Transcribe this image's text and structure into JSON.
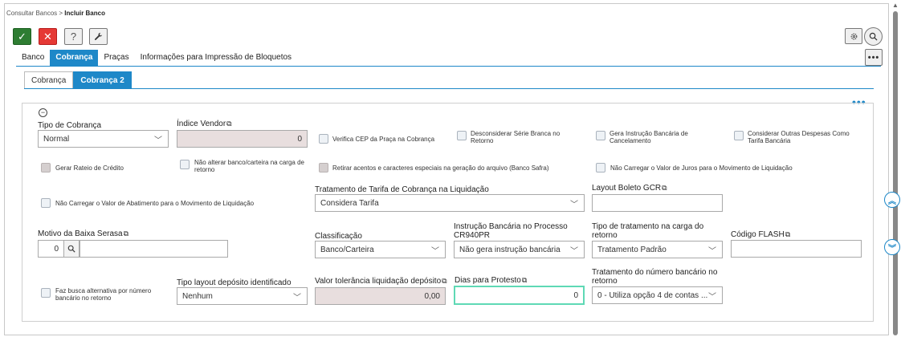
{
  "breadcrumb": {
    "parent": "Consultar Bancos",
    "separator": ">",
    "current": "Incluir Banco"
  },
  "toolbar": {
    "confirm": "✓",
    "cancel": "✕",
    "help": "?",
    "tool": "🔧"
  },
  "main_tabs": [
    "Banco",
    "Cobrança",
    "Praças",
    "Informações para Impressão de Bloquetos"
  ],
  "sub_tabs": [
    "Cobrança",
    "Cobrança 2"
  ],
  "more_dots": "•••",
  "collapse_symbol": "−",
  "copy_icon": "⧉",
  "fields": {
    "tipo_cobranca": {
      "label": "Tipo de Cobrança",
      "value": "Normal"
    },
    "indice_vendor": {
      "label": "Índice Vendor",
      "value": "0"
    },
    "tratamento_tarifa": {
      "label": "Tratamento de Tarifa de Cobrança na Liquidação",
      "value": "Considera Tarifa"
    },
    "layout_boleto": {
      "label": "Layout Boleto GCR",
      "value": ""
    },
    "motivo_baixa": {
      "label": "Motivo da Baixa Serasa",
      "value": "0",
      "desc": ""
    },
    "classificacao": {
      "label": "Classificação",
      "value": "Banco/Carteira"
    },
    "instrucao_bancaria": {
      "label": "Instrução Bancária no Processo CR940PR",
      "value": "Não gera instrução bancária"
    },
    "tipo_tratamento": {
      "label": "Tipo de tratamento na carga do retorno",
      "value": "Tratamento Padrão"
    },
    "codigo_flash": {
      "label": "Código FLASH",
      "value": ""
    },
    "tipo_layout": {
      "label": "Tipo layout depósito identificado",
      "value": "Nenhum"
    },
    "valor_tolerancia": {
      "label": "Valor tolerância liquidação depósito",
      "value": "0,00"
    },
    "dias_protesto": {
      "label": "Dias para Protesto",
      "value": "0"
    },
    "tratamento_numero": {
      "label": "Tratamento do número bancário no retorno",
      "value": "0 - Utiliza opção 4 de contas ..."
    }
  },
  "checkboxes": {
    "verifica_cep": "Verifica CEP da Praça na Cobrança",
    "desconsiderar_serie": "Desconsiderar Série Branca no Retorno",
    "gera_instrucao": "Gera Instrução Bancária de Cancelamento",
    "considerar_despesas": "Considerar Outras Despesas Como Tarifa Bancária",
    "gerar_rateio": "Gerar Rateio de Crédito",
    "nao_alterar": "Não alterar banco/carteira na carga de retorno",
    "retirar_acentos": "Retirar acentos e caracteres especiais na geração do arquivo (Banco Safra)",
    "nao_carregar_juros": "Não Carregar o Valor de Juros para o Movimento de Liquidação",
    "nao_carregar_abatimento": "Não Carregar o Valor de Abatimento para o Movimento de Liquidação",
    "faz_busca": "Faz busca alternativa por número bancário no retorno"
  },
  "colors": {
    "accent": "#1e88c8",
    "confirm": "#2e7d32",
    "cancel": "#e53935",
    "focus": "#5fd9b5"
  }
}
